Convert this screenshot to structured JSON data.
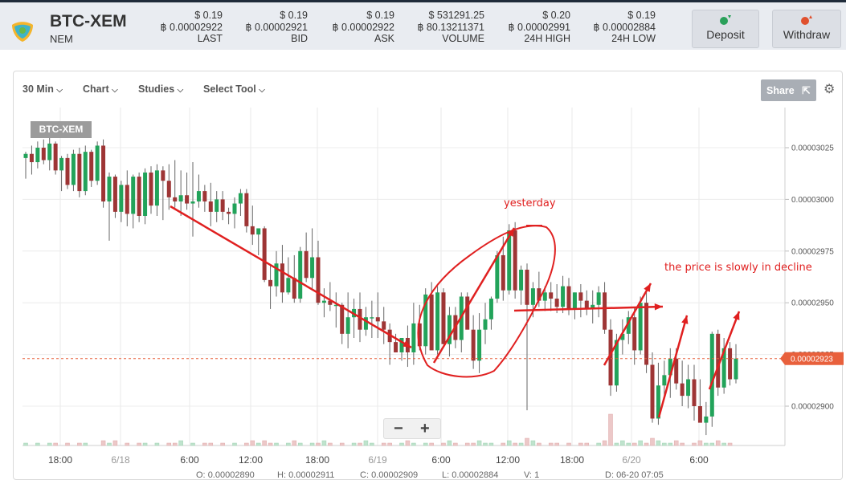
{
  "header": {
    "pair": "BTC-XEM",
    "coin": "NEM",
    "stats": [
      {
        "usd": "$ 0.19",
        "btc": "฿ 0.00002922",
        "label": "LAST"
      },
      {
        "usd": "$ 0.19",
        "btc": "฿ 0.00002921",
        "label": "BID"
      },
      {
        "usd": "$ 0.19",
        "btc": "฿ 0.00002922",
        "label": "ASK"
      },
      {
        "usd": "$ 531291.25",
        "btc": "฿ 80.13211371",
        "label": "VOLUME"
      },
      {
        "usd": "$ 0.20",
        "btc": "฿ 0.00002991",
        "label": "24H HIGH"
      },
      {
        "usd": "$ 0.19",
        "btc": "฿ 0.00002884",
        "label": "24H LOW"
      }
    ],
    "deposit_label": "Deposit",
    "withdraw_label": "Withdraw"
  },
  "toolbar": {
    "interval": "30 Min",
    "chart": "Chart",
    "studies": "Studies",
    "select_tool": "Select Tool",
    "share": "Share"
  },
  "chart": {
    "symbol_tag": "BTC-XEM",
    "price_tag": "0.00002923",
    "annotations": {
      "yesterday": "yesterday",
      "decline": "the price is slowly in decline"
    },
    "colors": {
      "up": "#22a35a",
      "down": "#9e3535",
      "annotation": "#e02020",
      "price_tag": "#e8603c"
    }
  },
  "chart_data": {
    "type": "candlestick",
    "y_ticks": [
      "0.00003025",
      "0.00003000",
      "0.00002975",
      "0.00002950",
      "0.00002925",
      "0.00002900"
    ],
    "x_ticks": [
      "18:00",
      "6/18",
      "6:00",
      "12:00",
      "18:00",
      "6/19",
      "6:00",
      "12:00",
      "18:00",
      "6/20",
      "6:00"
    ],
    "last_price": 2.923e-05,
    "candles": [
      [
        3.02e-05,
        3.023e-05,
        3.01e-05,
        3.022e-05
      ],
      [
        3.022e-05,
        3.026e-05,
        3.012e-05,
        3.018e-05
      ],
      [
        3.018e-05,
        3.028e-05,
        3.015e-05,
        3.025e-05
      ],
      [
        3.025e-05,
        3.029e-05,
        3.017e-05,
        3.019e-05
      ],
      [
        3.019e-05,
        3.03e-05,
        3.014e-05,
        3.027e-05
      ],
      [
        3.027e-05,
        3.028e-05,
        3.012e-05,
        3.014e-05
      ],
      [
        3.014e-05,
        3.021e-05,
        3.004e-05,
        3.02e-05
      ],
      [
        3.02e-05,
        3.022e-05,
        3.005e-05,
        3.007e-05
      ],
      [
        3.007e-05,
        3.024e-05,
        3.004e-05,
        3.022e-05
      ],
      [
        3.022e-05,
        3.025e-05,
        3.001e-05,
        3.004e-05
      ],
      [
        3.004e-05,
        3.026e-05,
        3.002e-05,
        3.023e-05
      ],
      [
        3.023e-05,
        3.024e-05,
        3.006e-05,
        3.009e-05
      ],
      [
        3.009e-05,
        3.028e-05,
        3.007e-05,
        3.026e-05
      ],
      [
        3.026e-05,
        3.029e-05,
        2.996e-05,
        2.999e-05
      ],
      [
        2.999e-05,
        3.013e-05,
        2.98e-05,
        3.011e-05
      ],
      [
        3.011e-05,
        3.012e-05,
        2.991e-05,
        2.994e-05
      ],
      [
        2.994e-05,
        3.009e-05,
        2.989e-05,
        3.007e-05
      ],
      [
        3.007e-05,
        3.014e-05,
        2.987e-05,
        2.993e-05
      ],
      [
        2.993e-05,
        3.012e-05,
        2.986e-05,
        3.011e-05
      ],
      [
        3.011e-05,
        3.013e-05,
        2.989e-05,
        2.992e-05
      ],
      [
        2.992e-05,
        3.015e-05,
        2.988e-05,
        3.013e-05
      ],
      [
        3.013e-05,
        3.016e-05,
        2.993e-05,
        2.997e-05
      ],
      [
        2.997e-05,
        3.017e-05,
        2.992e-05,
        3.014e-05
      ],
      [
        3.014e-05,
        3.016e-05,
        2.99e-05,
        3.009e-05
      ],
      [
        3.009e-05,
        3.017e-05,
        2.995e-05,
        3.001e-05
      ],
      [
        3.001e-05,
        3.019e-05,
        2.996e-05,
        2.999e-05
      ],
      [
        2.999e-05,
        3.014e-05,
        2.992e-05,
        3.002e-05
      ],
      [
        3.002e-05,
        3.013e-05,
        2.995e-05,
        2.998e-05
      ],
      [
        2.998e-05,
        3.018e-05,
        2.982e-05,
        2.999e-05
      ],
      [
        2.999e-05,
        3.012e-05,
        2.996e-05,
        3.004e-05
      ],
      [
        3.004e-05,
        3.007e-05,
        2.994e-05,
        2.999e-05
      ],
      [
        2.999e-05,
        3.008e-05,
        2.987e-05,
        2.994e-05
      ],
      [
        2.994e-05,
        3.004e-05,
        2.989e-05,
        3e-05
      ],
      [
        3e-05,
        3.004e-05,
        2.99e-05,
        2.994e-05
      ],
      [
        2.994e-05,
        2.996e-05,
        2.988e-05,
        2.993e-05
      ],
      [
        2.993e-05,
        3.001e-05,
        2.986e-05,
        2.998e-05
      ],
      [
        2.998e-05,
        3.005e-05,
        2.992e-05,
        3.003e-05
      ],
      [
        3.003e-05,
        3.005e-05,
        2.984e-05,
        2.987e-05
      ],
      [
        2.987e-05,
        2.997e-05,
        2.978e-05,
        2.983e-05
      ],
      [
        2.983e-05,
        2.986e-05,
        2.973e-05,
        2.986e-05
      ],
      [
        2.986e-05,
        2.987e-05,
        2.96e-05,
        2.961e-05
      ],
      [
        2.961e-05,
        2.968e-05,
        2.947e-05,
        2.958e-05
      ],
      [
        2.958e-05,
        2.975e-05,
        2.953e-05,
        2.969e-05
      ],
      [
        2.969e-05,
        2.978e-05,
        2.95e-05,
        2.955e-05
      ],
      [
        2.955e-05,
        2.972e-05,
        2.954e-05,
        2.962e-05
      ],
      [
        2.962e-05,
        2.973e-05,
        2.95e-05,
        2.952e-05
      ],
      [
        2.952e-05,
        2.977e-05,
        2.95e-05,
        2.975e-05
      ],
      [
        2.975e-05,
        2.984e-05,
        2.96e-05,
        2.962e-05
      ],
      [
        2.962e-05,
        2.986e-05,
        2.956e-05,
        2.972e-05
      ],
      [
        2.972e-05,
        2.98e-05,
        2.949e-05,
        2.95e-05
      ],
      [
        2.95e-05,
        2.957e-05,
        2.943e-05,
        2.951e-05
      ],
      [
        2.951e-05,
        2.96e-05,
        2.946e-05,
        2.949e-05
      ],
      [
        2.949e-05,
        2.955e-05,
        2.938e-05,
        2.949e-05
      ],
      [
        2.949e-05,
        2.95e-05,
        2.93e-05,
        2.935e-05
      ],
      [
        2.935e-05,
        2.955e-05,
        2.928e-05,
        2.943e-05
      ],
      [
        2.943e-05,
        2.952e-05,
        2.933e-05,
        2.947e-05
      ],
      [
        2.947e-05,
        2.955e-05,
        2.931e-05,
        2.937e-05
      ],
      [
        2.937e-05,
        2.948e-05,
        2.934e-05,
        2.943e-05
      ],
      [
        2.943e-05,
        2.951e-05,
        2.933e-05,
        2.943e-05
      ],
      [
        2.943e-05,
        2.955e-05,
        2.933e-05,
        2.941e-05
      ],
      [
        2.941e-05,
        2.948e-05,
        2.93e-05,
        2.937e-05
      ],
      [
        2.937e-05,
        2.94e-05,
        2.92e-05,
        2.931e-05
      ],
      [
        2.931e-05,
        2.935e-05,
        2.926e-05,
        2.926e-05
      ],
      [
        2.926e-05,
        2.933e-05,
        2.922e-05,
        2.933e-05
      ],
      [
        2.933e-05,
        2.939e-05,
        2.919e-05,
        2.926e-05
      ],
      [
        2.926e-05,
        2.95e-05,
        2.92e-05,
        2.94e-05
      ],
      [
        2.94e-05,
        2.949e-05,
        2.927e-05,
        2.929e-05
      ],
      [
        2.929e-05,
        2.957e-05,
        2.925e-05,
        2.954e-05
      ],
      [
        2.954e-05,
        2.96e-05,
        2.93e-05,
        2.927e-05
      ],
      [
        2.927e-05,
        2.958e-05,
        2.925e-05,
        2.955e-05
      ],
      [
        2.955e-05,
        2.957e-05,
        2.93e-05,
        2.93e-05
      ],
      [
        2.93e-05,
        2.948e-05,
        2.924e-05,
        2.944e-05
      ],
      [
        2.944e-05,
        2.948e-05,
        2.928e-05,
        2.932e-05
      ],
      [
        2.932e-05,
        2.955e-05,
        2.926e-05,
        2.953e-05
      ],
      [
        2.953e-05,
        2.955e-05,
        2.94e-05,
        2.937e-05
      ],
      [
        2.937e-05,
        2.944e-05,
        2.918e-05,
        2.922e-05
      ],
      [
        2.922e-05,
        2.945e-05,
        2.916e-05,
        2.937e-05
      ],
      [
        2.937e-05,
        2.95e-05,
        2.93e-05,
        2.942e-05
      ],
      [
        2.942e-05,
        2.953e-05,
        2.937e-05,
        2.952e-05
      ],
      [
        2.952e-05,
        2.975e-05,
        2.95e-05,
        2.973e-05
      ],
      [
        2.973e-05,
        2.982e-05,
        2.951e-05,
        2.956e-05
      ],
      [
        2.956e-05,
        2.988e-05,
        2.954e-05,
        2.985e-05
      ],
      [
        2.985e-05,
        2.989e-05,
        2.952e-05,
        2.956e-05
      ],
      [
        2.956e-05,
        2.968e-05,
        2.949e-05,
        2.966e-05
      ],
      [
        2.966e-05,
        2.969e-05,
        2.898e-05,
        2.949e-05
      ],
      [
        2.949e-05,
        2.96e-05,
        2.943e-05,
        2.957e-05
      ],
      [
        2.957e-05,
        2.965e-05,
        2.948e-05,
        2.951e-05
      ],
      [
        2.951e-05,
        2.958e-05,
        2.946e-05,
        2.955e-05
      ],
      [
        2.955e-05,
        2.96e-05,
        2.946e-05,
        2.952e-05
      ],
      [
        2.952e-05,
        2.959e-05,
        2.945e-05,
        2.948e-05
      ],
      [
        2.948e-05,
        2.963e-05,
        2.945e-05,
        2.958e-05
      ],
      [
        2.958e-05,
        2.962e-05,
        2.944e-05,
        2.947e-05
      ],
      [
        2.947e-05,
        2.955e-05,
        2.942e-05,
        2.955e-05
      ],
      [
        2.955e-05,
        2.959e-05,
        2.943e-05,
        2.951e-05
      ],
      [
        2.951e-05,
        2.956e-05,
        2.944e-05,
        2.947e-05
      ],
      [
        2.947e-05,
        2.956e-05,
        2.94e-05,
        2.949e-05
      ],
      [
        2.949e-05,
        2.958e-05,
        2.943e-05,
        2.955e-05
      ],
      [
        2.955e-05,
        2.96e-05,
        2.935e-05,
        2.937e-05
      ],
      [
        2.937e-05,
        2.942e-05,
        2.905e-05,
        2.91e-05
      ],
      [
        2.91e-05,
        2.935e-05,
        2.907e-05,
        2.932e-05
      ],
      [
        2.932e-05,
        2.942e-05,
        2.925e-05,
        2.935e-05
      ],
      [
        2.935e-05,
        2.946e-05,
        2.93e-05,
        2.943e-05
      ],
      [
        2.943e-05,
        2.948e-05,
        2.92e-05,
        2.927e-05
      ],
      [
        2.927e-05,
        2.953e-05,
        2.925e-05,
        2.95e-05
      ],
      [
        2.95e-05,
        2.956e-05,
        2.916e-05,
        2.92e-05
      ],
      [
        2.92e-05,
        2.926e-05,
        2.892e-05,
        2.894e-05
      ],
      [
        2.894e-05,
        2.921e-05,
        2.891e-05,
        2.91e-05
      ],
      [
        2.91e-05,
        2.922e-05,
        2.905e-05,
        2.915e-05
      ],
      [
        2.915e-05,
        2.928e-05,
        2.904e-05,
        2.923e-05
      ],
      [
        2.923e-05,
        2.928e-05,
        2.908e-05,
        2.911e-05
      ],
      [
        2.911e-05,
        2.922e-05,
        2.9e-05,
        2.905e-05
      ],
      [
        2.905e-05,
        2.92e-05,
        2.899e-05,
        2.913e-05
      ],
      [
        2.913e-05,
        2.92e-05,
        2.893e-05,
        2.9e-05
      ],
      [
        2.9e-05,
        2.913e-05,
        2.893e-05,
        2.892e-05
      ],
      [
        2.892e-05,
        2.902e-05,
        2.886e-05,
        2.895e-05
      ],
      [
        2.895e-05,
        2.936e-05,
        2.89e-05,
        2.935e-05
      ],
      [
        2.935e-05,
        2.937e-05,
        2.905e-05,
        2.909e-05
      ],
      [
        2.909e-05,
        2.933e-05,
        2.906e-05,
        2.928e-05
      ],
      [
        2.928e-05,
        2.931e-05,
        2.91e-05,
        2.913e-05
      ],
      [
        2.913e-05,
        2.93e-05,
        2.911e-05,
        2.923e-05
      ]
    ],
    "volumes": [
      1,
      0,
      1,
      0,
      1,
      1,
      0,
      1,
      0,
      1,
      1,
      0,
      0,
      2,
      1,
      2,
      0,
      1,
      0,
      1,
      1,
      0,
      1,
      0,
      1,
      1,
      2,
      0,
      1,
      0,
      1,
      1,
      0,
      1,
      0,
      1,
      0,
      1,
      2,
      1,
      2,
      1,
      1,
      0,
      1,
      2,
      1,
      0,
      1,
      1,
      2,
      1,
      0,
      1,
      0,
      1,
      1,
      2,
      1,
      0,
      1,
      1,
      0,
      1,
      2,
      1,
      0,
      1,
      1,
      0,
      1,
      2,
      1,
      0,
      1,
      1,
      2,
      1,
      1,
      0,
      1,
      2,
      1,
      1,
      3,
      2,
      1,
      0,
      1,
      1,
      0,
      1,
      0,
      1,
      1,
      0,
      1,
      2,
      13,
      1,
      2,
      1,
      1,
      2,
      1,
      3,
      2,
      1,
      1,
      2,
      1,
      0,
      1,
      2,
      1,
      1,
      2,
      1,
      1
    ]
  },
  "footer_ohlc": [
    {
      "k": "O:",
      "v": "0.00002890"
    },
    {
      "k": "H:",
      "v": "0.00002911"
    },
    {
      "k": "C:",
      "v": "0.00002909"
    },
    {
      "k": "L:",
      "v": "0.00002884"
    },
    {
      "k": "V:",
      "v": "1"
    },
    {
      "k": "D:",
      "v": "06-20 07:05"
    }
  ]
}
